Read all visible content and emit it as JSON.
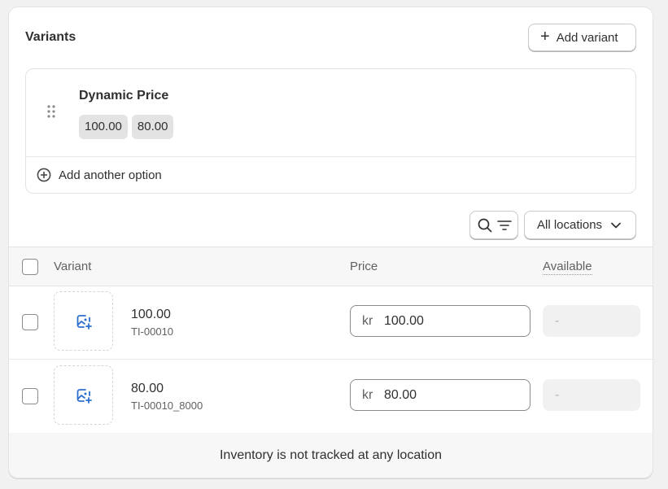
{
  "card": {
    "title": "Variants",
    "add_variant_label": "Add variant"
  },
  "option": {
    "name": "Dynamic Price",
    "values": [
      "100.00",
      "80.00"
    ],
    "add_option_label": "Add another option"
  },
  "toolbar": {
    "location_label": "All locations"
  },
  "table": {
    "headers": {
      "variant": "Variant",
      "price": "Price",
      "available": "Available"
    },
    "rows": [
      {
        "name": "100.00",
        "sku": "TI-00010",
        "currency": "kr",
        "price": "100.00",
        "available": "-"
      },
      {
        "name": "80.00",
        "sku": "TI-00010_8000",
        "currency": "kr",
        "price": "80.00",
        "available": "-"
      }
    ]
  },
  "footer": {
    "message": "Inventory is not tracked at any location"
  },
  "colors": {
    "accent_icon": "#2c6ecb",
    "border": "#e3e3e3"
  }
}
